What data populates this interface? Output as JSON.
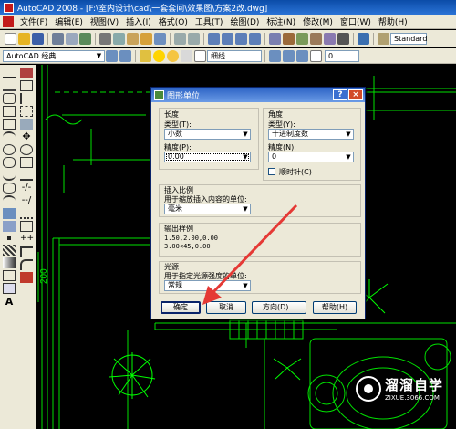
{
  "window": {
    "title": "AutoCAD 2008 - [F:\\室内设计\\cad\\一套套间\\效果图\\方案2改.dwg]"
  },
  "menu": [
    "文件(F)",
    "编辑(E)",
    "视图(V)",
    "插入(I)",
    "格式(O)",
    "工具(T)",
    "绘图(D)",
    "标注(N)",
    "修改(M)",
    "窗口(W)",
    "帮助(H)"
  ],
  "toolbar": {
    "style_combo": "Standard",
    "workspace_combo": "AutoCAD 经典",
    "layer_combo": "0",
    "linetype_label": "细线"
  },
  "canvas": {
    "dimension_text": "200"
  },
  "dialog": {
    "title": "图形单位",
    "length": {
      "group_label": "长度",
      "type_label": "类型(T):",
      "type_value": "小数",
      "precision_label": "精度(P):",
      "precision_value": "0.00"
    },
    "angle": {
      "group_label": "角度",
      "type_label": "类型(Y):",
      "type_value": "十进制度数",
      "precision_label": "精度(N):",
      "precision_value": "0",
      "clockwise_label": "顺时针(C)",
      "clockwise_checked": false
    },
    "insert": {
      "group_label": "插入比例",
      "units_label": "用于缩放插入内容的单位:",
      "units_value": "毫米"
    },
    "output": {
      "group_label": "输出样例",
      "line1": "1.50,2.00,0.00",
      "line2": "3.00<45,0.00"
    },
    "lighting": {
      "group_label": "光源",
      "units_label": "用于指定光源强度的单位:",
      "units_value": "常规"
    },
    "buttons": {
      "ok": "确定",
      "cancel": "取消",
      "direction": "方向(D)...",
      "help": "帮助(H)"
    }
  },
  "watermark": {
    "name": "溜溜自学",
    "url": "ZIXUE.3066.COM"
  },
  "colors": {
    "cad_line": "#00e000",
    "arrow": "#e53935",
    "titlebar": "#0b4ca8",
    "dialog_bg": "#ece9d8"
  }
}
